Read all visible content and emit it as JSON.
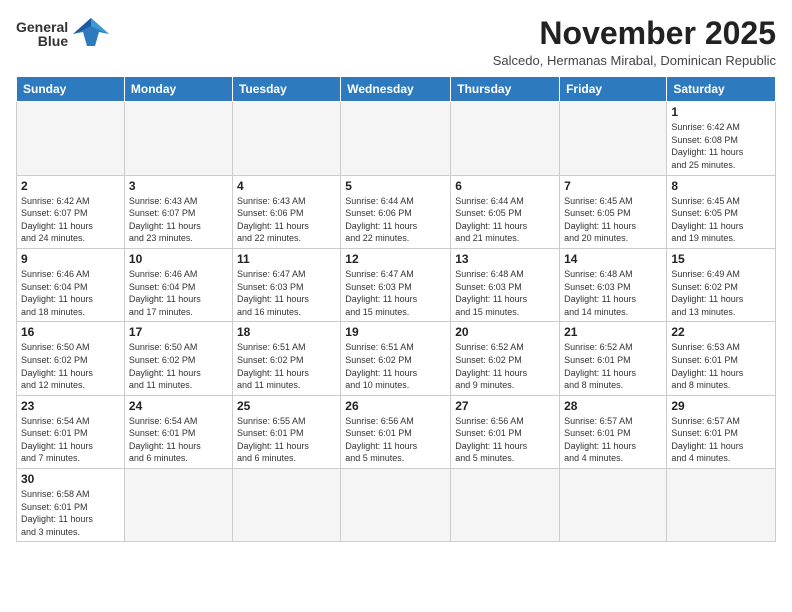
{
  "logo": {
    "line1": "General",
    "line2": "Blue"
  },
  "header": {
    "title": "November 2025",
    "subtitle": "Salcedo, Hermanas Mirabal, Dominican Republic"
  },
  "weekdays": [
    "Sunday",
    "Monday",
    "Tuesday",
    "Wednesday",
    "Thursday",
    "Friday",
    "Saturday"
  ],
  "weeks": [
    [
      {
        "day": "",
        "info": ""
      },
      {
        "day": "",
        "info": ""
      },
      {
        "day": "",
        "info": ""
      },
      {
        "day": "",
        "info": ""
      },
      {
        "day": "",
        "info": ""
      },
      {
        "day": "",
        "info": ""
      },
      {
        "day": "1",
        "info": "Sunrise: 6:42 AM\nSunset: 6:08 PM\nDaylight: 11 hours\nand 25 minutes."
      }
    ],
    [
      {
        "day": "2",
        "info": "Sunrise: 6:42 AM\nSunset: 6:07 PM\nDaylight: 11 hours\nand 24 minutes."
      },
      {
        "day": "3",
        "info": "Sunrise: 6:43 AM\nSunset: 6:07 PM\nDaylight: 11 hours\nand 23 minutes."
      },
      {
        "day": "4",
        "info": "Sunrise: 6:43 AM\nSunset: 6:06 PM\nDaylight: 11 hours\nand 22 minutes."
      },
      {
        "day": "5",
        "info": "Sunrise: 6:44 AM\nSunset: 6:06 PM\nDaylight: 11 hours\nand 22 minutes."
      },
      {
        "day": "6",
        "info": "Sunrise: 6:44 AM\nSunset: 6:05 PM\nDaylight: 11 hours\nand 21 minutes."
      },
      {
        "day": "7",
        "info": "Sunrise: 6:45 AM\nSunset: 6:05 PM\nDaylight: 11 hours\nand 20 minutes."
      },
      {
        "day": "8",
        "info": "Sunrise: 6:45 AM\nSunset: 6:05 PM\nDaylight: 11 hours\nand 19 minutes."
      }
    ],
    [
      {
        "day": "9",
        "info": "Sunrise: 6:46 AM\nSunset: 6:04 PM\nDaylight: 11 hours\nand 18 minutes."
      },
      {
        "day": "10",
        "info": "Sunrise: 6:46 AM\nSunset: 6:04 PM\nDaylight: 11 hours\nand 17 minutes."
      },
      {
        "day": "11",
        "info": "Sunrise: 6:47 AM\nSunset: 6:03 PM\nDaylight: 11 hours\nand 16 minutes."
      },
      {
        "day": "12",
        "info": "Sunrise: 6:47 AM\nSunset: 6:03 PM\nDaylight: 11 hours\nand 15 minutes."
      },
      {
        "day": "13",
        "info": "Sunrise: 6:48 AM\nSunset: 6:03 PM\nDaylight: 11 hours\nand 15 minutes."
      },
      {
        "day": "14",
        "info": "Sunrise: 6:48 AM\nSunset: 6:03 PM\nDaylight: 11 hours\nand 14 minutes."
      },
      {
        "day": "15",
        "info": "Sunrise: 6:49 AM\nSunset: 6:02 PM\nDaylight: 11 hours\nand 13 minutes."
      }
    ],
    [
      {
        "day": "16",
        "info": "Sunrise: 6:50 AM\nSunset: 6:02 PM\nDaylight: 11 hours\nand 12 minutes."
      },
      {
        "day": "17",
        "info": "Sunrise: 6:50 AM\nSunset: 6:02 PM\nDaylight: 11 hours\nand 11 minutes."
      },
      {
        "day": "18",
        "info": "Sunrise: 6:51 AM\nSunset: 6:02 PM\nDaylight: 11 hours\nand 11 minutes."
      },
      {
        "day": "19",
        "info": "Sunrise: 6:51 AM\nSunset: 6:02 PM\nDaylight: 11 hours\nand 10 minutes."
      },
      {
        "day": "20",
        "info": "Sunrise: 6:52 AM\nSunset: 6:02 PM\nDaylight: 11 hours\nand 9 minutes."
      },
      {
        "day": "21",
        "info": "Sunrise: 6:52 AM\nSunset: 6:01 PM\nDaylight: 11 hours\nand 8 minutes."
      },
      {
        "day": "22",
        "info": "Sunrise: 6:53 AM\nSunset: 6:01 PM\nDaylight: 11 hours\nand 8 minutes."
      }
    ],
    [
      {
        "day": "23",
        "info": "Sunrise: 6:54 AM\nSunset: 6:01 PM\nDaylight: 11 hours\nand 7 minutes."
      },
      {
        "day": "24",
        "info": "Sunrise: 6:54 AM\nSunset: 6:01 PM\nDaylight: 11 hours\nand 6 minutes."
      },
      {
        "day": "25",
        "info": "Sunrise: 6:55 AM\nSunset: 6:01 PM\nDaylight: 11 hours\nand 6 minutes."
      },
      {
        "day": "26",
        "info": "Sunrise: 6:56 AM\nSunset: 6:01 PM\nDaylight: 11 hours\nand 5 minutes."
      },
      {
        "day": "27",
        "info": "Sunrise: 6:56 AM\nSunset: 6:01 PM\nDaylight: 11 hours\nand 5 minutes."
      },
      {
        "day": "28",
        "info": "Sunrise: 6:57 AM\nSunset: 6:01 PM\nDaylight: 11 hours\nand 4 minutes."
      },
      {
        "day": "29",
        "info": "Sunrise: 6:57 AM\nSunset: 6:01 PM\nDaylight: 11 hours\nand 4 minutes."
      }
    ],
    [
      {
        "day": "30",
        "info": "Sunrise: 6:58 AM\nSunset: 6:01 PM\nDaylight: 11 hours\nand 3 minutes."
      },
      {
        "day": "",
        "info": ""
      },
      {
        "day": "",
        "info": ""
      },
      {
        "day": "",
        "info": ""
      },
      {
        "day": "",
        "info": ""
      },
      {
        "day": "",
        "info": ""
      },
      {
        "day": "",
        "info": ""
      }
    ]
  ]
}
